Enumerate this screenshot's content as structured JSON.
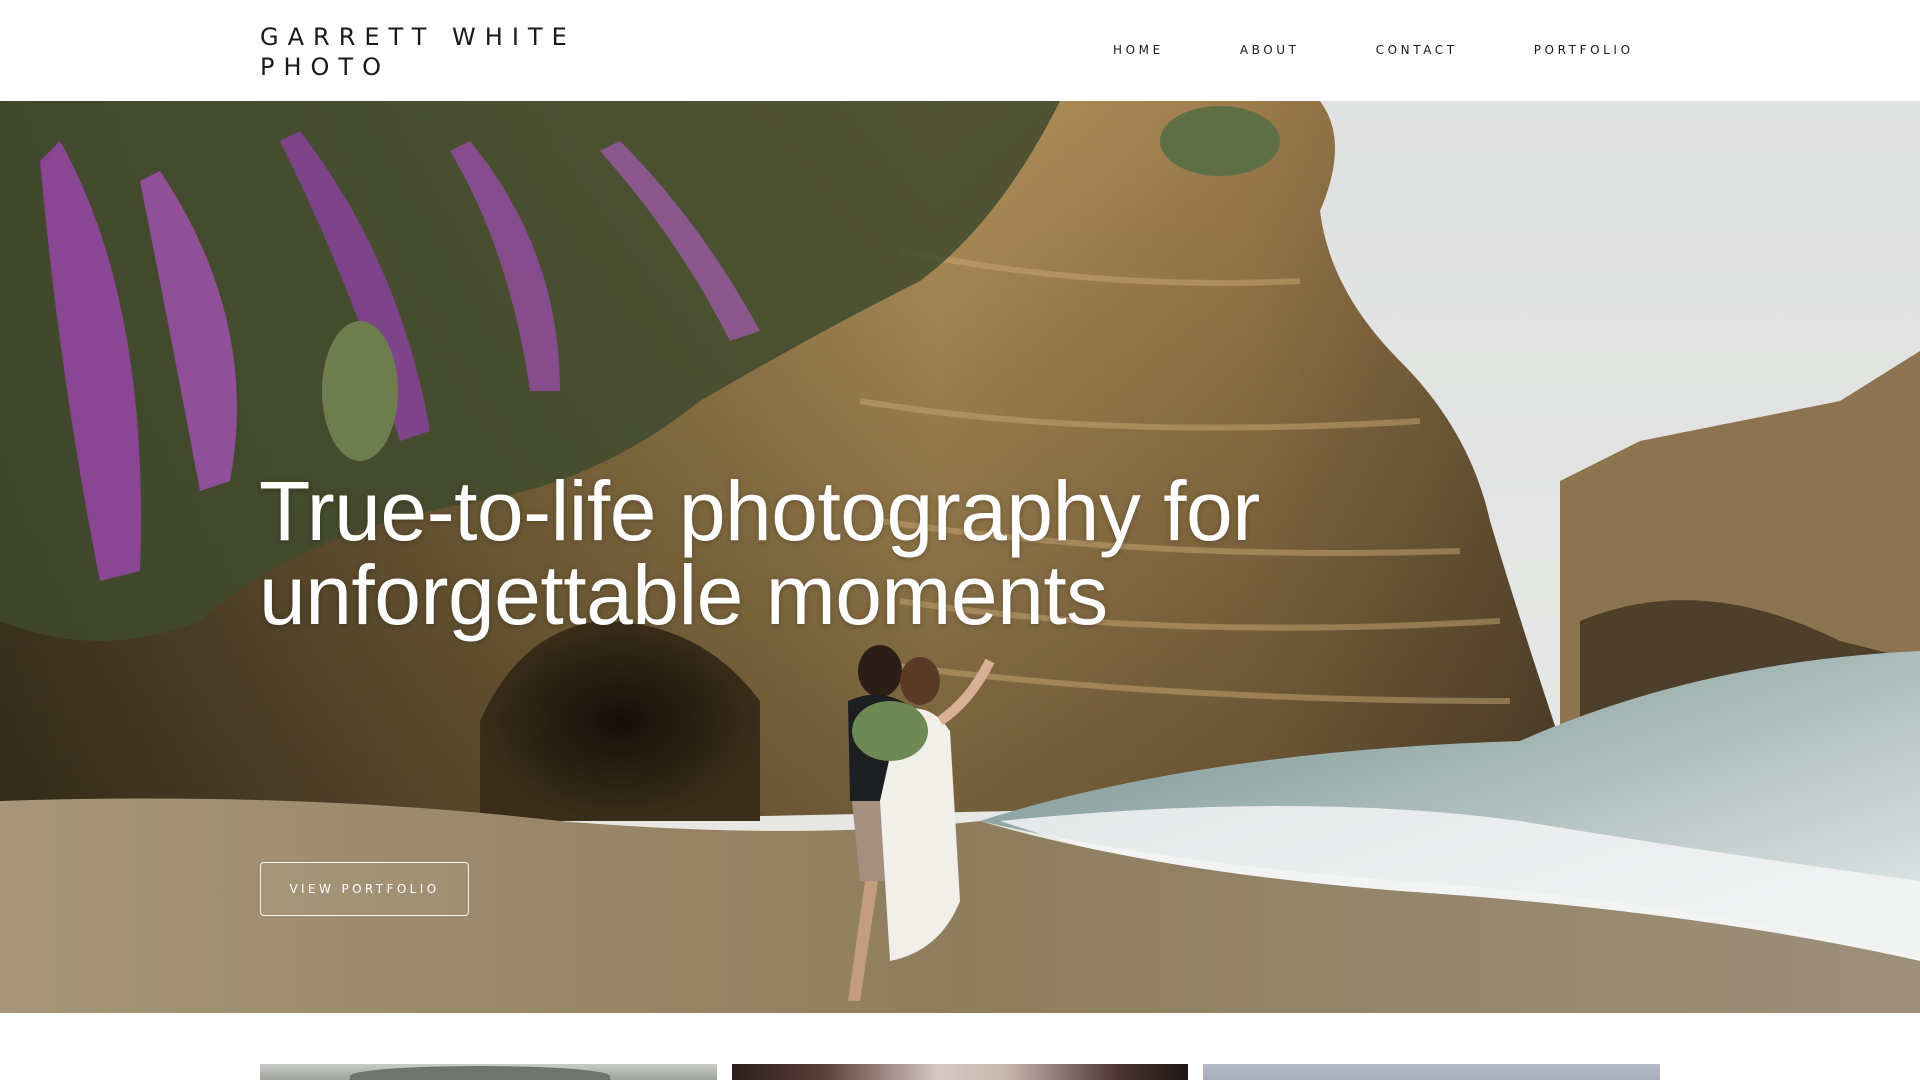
{
  "header": {
    "logo_line1": "GARRETT WHITE",
    "logo_line2": "PHOTO",
    "nav": {
      "home": "HOME",
      "about": "ABOUT",
      "contact": "CONTACT",
      "portfolio": "PORTFOLIO"
    }
  },
  "hero": {
    "title_line1": "True-to-life photography for",
    "title_line2": "unforgettable moments",
    "cta_label": "VIEW PORTFOLIO"
  },
  "colors": {
    "text_dark": "#1a1a1a",
    "background": "#ffffff",
    "hero_text": "#ffffff"
  }
}
